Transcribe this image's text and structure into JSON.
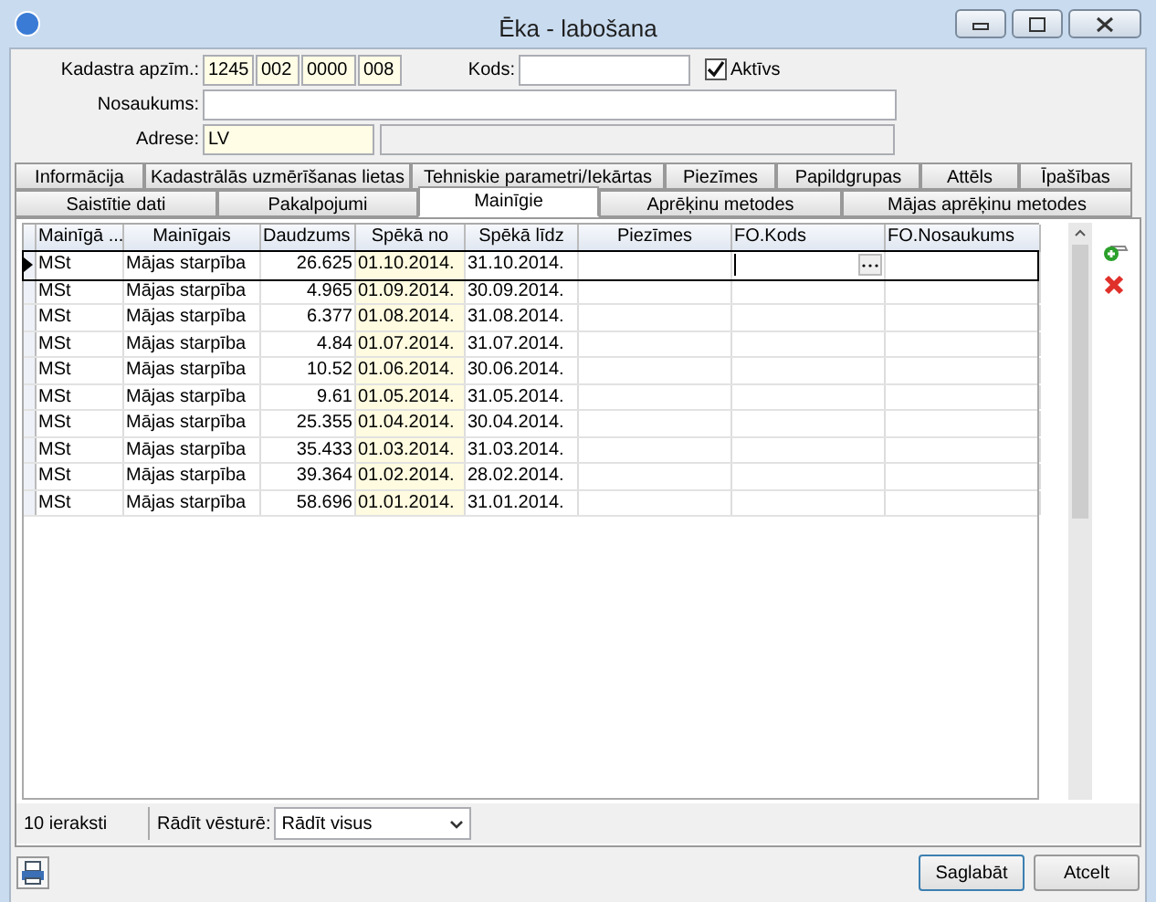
{
  "window": {
    "title": "Ēka - labošana"
  },
  "form": {
    "cadastre_label": "Kadastra apzīm.:",
    "cadastre_parts": [
      "1245",
      "002",
      "0000",
      "008"
    ],
    "code_label": "Kods:",
    "active": {
      "label": "Aktīvs",
      "checked": true
    },
    "name_label": "Nosaukums:",
    "address_label": "Adrese:",
    "address_value": "LV"
  },
  "tabs_row_1": [
    {
      "label": "Informācija",
      "selected": false
    },
    {
      "label": "Kadastrālās uzmērīšanas lietas",
      "selected": false
    },
    {
      "label": "Tehniskie parametri/Iekārtas",
      "selected": false
    },
    {
      "label": "Piezīmes",
      "selected": false
    },
    {
      "label": "Papildgrupas",
      "selected": false
    },
    {
      "label": "Attēls",
      "selected": false
    },
    {
      "label": "Īpašības",
      "selected": false
    }
  ],
  "tabs_row_2": [
    {
      "label": "Saistītie dati",
      "selected": false
    },
    {
      "label": "Pakalpojumi",
      "selected": false
    },
    {
      "label": "Mainīgie",
      "selected": true
    },
    {
      "label": "Aprēķinu metodes",
      "selected": false
    },
    {
      "label": "Mājas aprēķinu metodes",
      "selected": false
    }
  ],
  "table": {
    "columns": [
      "Mainīgā ...",
      "Mainīgais",
      "Daudzums",
      "Spēkā no",
      "Spēkā līdz",
      "Piezīmes",
      "FO.Kods",
      "FO.Nosaukums"
    ],
    "rows": [
      {
        "selected": true,
        "cells": [
          "MSt",
          "Mājas starpība",
          "26.625",
          "01.10.2014.",
          "31.10.2014.",
          "",
          "",
          ""
        ]
      },
      {
        "selected": false,
        "cells": [
          "MSt",
          "Mājas starpība",
          "4.965",
          "01.09.2014.",
          "30.09.2014.",
          "",
          "",
          ""
        ]
      },
      {
        "selected": false,
        "cells": [
          "MSt",
          "Mājas starpība",
          "6.377",
          "01.08.2014.",
          "31.08.2014.",
          "",
          "",
          ""
        ]
      },
      {
        "selected": false,
        "cells": [
          "MSt",
          "Mājas starpība",
          "4.84",
          "01.07.2014.",
          "31.07.2014.",
          "",
          "",
          ""
        ]
      },
      {
        "selected": false,
        "cells": [
          "MSt",
          "Mājas starpība",
          "10.52",
          "01.06.2014.",
          "30.06.2014.",
          "",
          "",
          ""
        ]
      },
      {
        "selected": false,
        "cells": [
          "MSt",
          "Mājas starpība",
          "9.61",
          "01.05.2014.",
          "31.05.2014.",
          "",
          "",
          ""
        ]
      },
      {
        "selected": false,
        "cells": [
          "MSt",
          "Mājas starpība",
          "25.355",
          "01.04.2014.",
          "30.04.2014.",
          "",
          "",
          ""
        ]
      },
      {
        "selected": false,
        "cells": [
          "MSt",
          "Mājas starpība",
          "35.433",
          "01.03.2014.",
          "31.03.2014.",
          "",
          "",
          ""
        ]
      },
      {
        "selected": false,
        "cells": [
          "MSt",
          "Mājas starpība",
          "39.364",
          "01.02.2014.",
          "28.02.2014.",
          "",
          "",
          ""
        ]
      },
      {
        "selected": false,
        "cells": [
          "MSt",
          "Mājas starpība",
          "58.696",
          "01.01.2014.",
          "31.01.2014.",
          "",
          "",
          ""
        ]
      }
    ]
  },
  "status": {
    "count": "10 ieraksti",
    "history_label": "Rādīt vēsturē:",
    "history_value": "Rādīt visus"
  },
  "buttons": [
    "Saglabāt",
    "Atcelt"
  ]
}
